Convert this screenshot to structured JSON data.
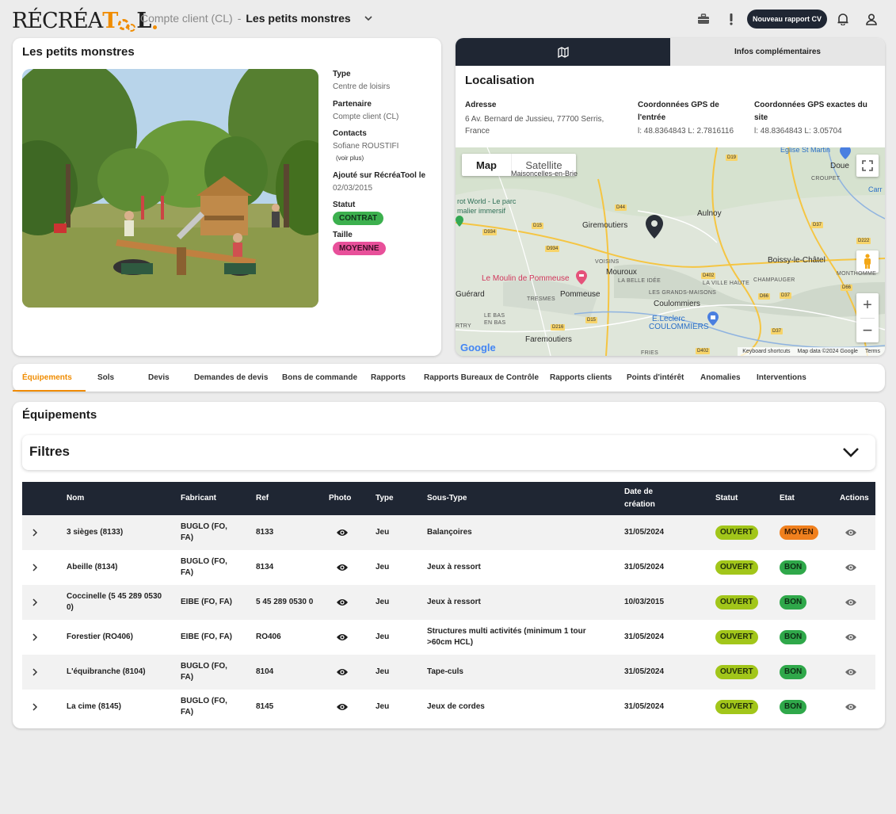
{
  "header": {
    "logo_text": "RÉCRÉATOOL",
    "breadcrumb_client": "Compte client (CL)",
    "breadcrumb_sep": "-",
    "breadcrumb_current": "Les petits monstres",
    "new_report_button": "Nouveau rapport CV",
    "icons": [
      "briefcase-icon",
      "alert-icon",
      "bell-icon",
      "user-icon"
    ]
  },
  "info": {
    "title": "Les petits monstres",
    "fields": [
      {
        "label": "Type",
        "value": "Centre de loisirs"
      },
      {
        "label": "Partenaire",
        "value": "Compte client (CL)"
      },
      {
        "label": "Contacts",
        "value": "Sofiane ROUSTIFI"
      }
    ],
    "see_more": "(voir plus)",
    "added_label": "Ajouté sur RécréaTool le",
    "added_value": "02/03/2015",
    "status_label": "Statut",
    "status_value": "CONTRAT",
    "size_label": "Taille",
    "size_value": "MOYENNE"
  },
  "location": {
    "tab_map_icon": "map-icon",
    "tab_info": "Infos complémentaires",
    "title": "Localisation",
    "address_label": "Adresse",
    "address_value": "6 Av. Bernard de Jussieu, 77700 Serris, France",
    "gps_entry_label": "Coordonnées GPS de l'entrée",
    "gps_entry_value": "l: 48.8364843 L: 2.7816116",
    "gps_site_label": "Coordonnées GPS exactes du site",
    "gps_site_value": "l: 48.8364843 L: 3.05704"
  },
  "map": {
    "btn_map": "Map",
    "btn_satellite": "Satellite",
    "places": {
      "eglise": "Eglise St Martin",
      "doue": "Doue",
      "croupet": "CROUPET",
      "carr": "Carr",
      "maisoncelles": "Maisoncelles-en-Brie",
      "world": "rot World - Le parc",
      "immersif": "malier immersif",
      "giremoutiers": "Giremoutiers",
      "aulnoy": "Aulnoy",
      "boissy": "Boissy-le-Châtel",
      "voisins": "VOISINS",
      "mouroux": "Mouroux",
      "belleidee": "LA BELLE IDÉE",
      "lavillehaute": "LA VILLE HAUTE",
      "champauger": "CHAMPAUGER",
      "montmorne": "MONTHOMME",
      "moulin": "Le Moulin de Pommeuse",
      "guerard": "Guérard",
      "pommeuse": "Pommeuse",
      "tresmes": "TRESMES",
      "grandesmaisons": "LES GRANDS-MAISONS",
      "coulommiers": "Coulommiers",
      "leclerc": "E.Leclerc",
      "coulommiers_caps": "COULOMMIERS",
      "lebas": "LE BAS",
      "enbas": "EN BAS",
      "rtry": "RTRY",
      "faremoutiers": "Faremoutiers",
      "fries": "FRIES"
    },
    "roads": [
      "D19",
      "D44",
      "D934",
      "D15",
      "D934",
      "D37",
      "D222",
      "D402",
      "D66",
      "D37",
      "D216",
      "D15",
      "D66",
      "D37",
      "D402"
    ],
    "google": "Google",
    "footer_shortcuts": "Keyboard shortcuts",
    "footer_data": "Map data ©2024 Google",
    "footer_terms": "Terms"
  },
  "tabs": [
    "Équipements",
    "Sols",
    "Devis",
    "Demandes de devis",
    "Bons de commande",
    "Rapports",
    "Rapports Bureaux de Contrôle",
    "Rapports clients",
    "Points d'intérêt",
    "Anomalies",
    "Interventions"
  ],
  "equipments": {
    "title": "Équipements",
    "filters_label": "Filtres",
    "columns": {
      "nom": "Nom",
      "fabricant": "Fabricant",
      "ref": "Ref",
      "photo": "Photo",
      "type": "Type",
      "soustype": "Sous-Type",
      "date": "Date de création",
      "statut": "Statut",
      "etat": "Etat",
      "actions": "Actions"
    },
    "rows": [
      {
        "nom": "3 sièges (8133)",
        "fabricant": "BUGLO (FO, FA)",
        "ref": "8133",
        "type": "Jeu",
        "soustype": "Balançoires",
        "date": "31/05/2024",
        "statut": "OUVERT",
        "etat": "MOYEN"
      },
      {
        "nom": "Abeille (8134)",
        "fabricant": "BUGLO (FO, FA)",
        "ref": "8134",
        "type": "Jeu",
        "soustype": "Jeux à ressort",
        "date": "31/05/2024",
        "statut": "OUVERT",
        "etat": "BON"
      },
      {
        "nom": "Coccinelle (5 45 289 0530 0)",
        "fabricant": "EIBE (FO, FA)",
        "ref": "5 45 289 0530 0",
        "type": "Jeu",
        "soustype": "Jeux à ressort",
        "date": "10/03/2015",
        "statut": "OUVERT",
        "etat": "BON"
      },
      {
        "nom": "Forestier (RO406)",
        "fabricant": "EIBE (FO, FA)",
        "ref": "RO406",
        "type": "Jeu",
        "soustype": "Structures multi activités (minimum 1 tour >60cm HCL)",
        "date": "31/05/2024",
        "statut": "OUVERT",
        "etat": "BON"
      },
      {
        "nom": "L'équibranche (8104)",
        "fabricant": "BUGLO (FO, FA)",
        "ref": "8104",
        "type": "Jeu",
        "soustype": "Tape-culs",
        "date": "31/05/2024",
        "statut": "OUVERT",
        "etat": "BON"
      },
      {
        "nom": "La cime (8145)",
        "fabricant": "BUGLO (FO, FA)",
        "ref": "8145",
        "type": "Jeu",
        "soustype": "Jeux de cordes",
        "date": "31/05/2024",
        "statut": "OUVERT",
        "etat": "BON"
      }
    ]
  }
}
